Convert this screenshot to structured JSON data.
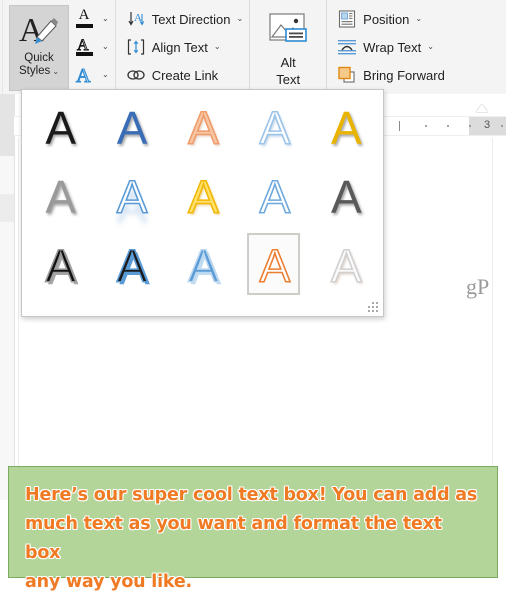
{
  "ribbon": {
    "groups": [
      {
        "name": "wordart-styles",
        "quick_styles": {
          "label_line1": "Quick",
          "label_line2": "Styles",
          "chevron": "⌄",
          "icon": "wordart-quick-styles-icon",
          "state": "selected"
        },
        "small_buttons": [
          {
            "label": "Text Fill",
            "icon": "text-fill-icon",
            "color": "#000000",
            "chevron": "⌄"
          },
          {
            "label": "Text Outline",
            "icon": "text-outline-icon",
            "color": "#000000",
            "chevron": "⌄"
          },
          {
            "label": "Text Effects",
            "icon": "text-effects-icon",
            "color": "#2e8bd4",
            "chevron": "⌄"
          }
        ]
      },
      {
        "name": "text-group",
        "items": [
          {
            "label": "Text Direction",
            "icon": "text-direction-icon",
            "chevron": "⌄"
          },
          {
            "label": "Align Text",
            "icon": "align-text-icon",
            "chevron": "⌄"
          },
          {
            "label": "Create Link",
            "icon": "create-link-icon",
            "chevron": ""
          }
        ]
      },
      {
        "name": "accessibility-group",
        "alt_text": {
          "label_line1": "Alt",
          "label_line2": "Text",
          "icon": "alt-text-picture-icon"
        }
      },
      {
        "name": "arrange-group",
        "items": [
          {
            "label": "Position",
            "icon": "position-icon",
            "chevron": "⌄"
          },
          {
            "label": "Wrap Text",
            "icon": "wrap-text-icon",
            "chevron": "⌄"
          },
          {
            "label": "Bring Forward",
            "icon": "bring-forward-icon",
            "chevron": ""
          }
        ]
      }
    ]
  },
  "gallery": {
    "name": "quick-styles-gallery",
    "letter": "A",
    "columns": 5,
    "rows": 3,
    "selected_index": 13,
    "resize_grip": "resize-grip-icon",
    "styles": [
      {
        "index": 0,
        "name": "fill-black-plain",
        "fill": "#1a1a1a",
        "outline": "none",
        "shadow": "soft-dark"
      },
      {
        "index": 1,
        "name": "fill-blue-plain",
        "fill": "#3a6db5",
        "outline": "none",
        "shadow": "soft-dark"
      },
      {
        "index": 2,
        "name": "fill-peach-outline-orange",
        "fill": "#f7c6a4",
        "outline": "#ef9c6a",
        "shadow": "soft-light"
      },
      {
        "index": 3,
        "name": "fill-white-outline-lightblue",
        "fill": "#ffffff",
        "outline": "#9cc3e8",
        "shadow": "soft-blue"
      },
      {
        "index": 4,
        "name": "fill-gold-plain",
        "fill": "#e8b400",
        "outline": "none",
        "shadow": "soft-dark"
      },
      {
        "index": 5,
        "name": "fill-gray-gradient",
        "fill": "#9a9a9a",
        "outline": "none",
        "shadow": "soft-dark"
      },
      {
        "index": 6,
        "name": "fill-white-reflect-blue",
        "fill": "#ffffff",
        "outline": "#5b9bd5",
        "shadow": "reflection-blue"
      },
      {
        "index": 7,
        "name": "fill-yellow-outline-gold",
        "fill": "#ffe16b",
        "outline": "#f2b705",
        "shadow": "soft-gold"
      },
      {
        "index": 8,
        "name": "fill-white-outline-blue-thin",
        "fill": "#ffffff",
        "outline": "#6fa8dc",
        "shadow": "none"
      },
      {
        "index": 9,
        "name": "fill-darkgray-plain",
        "fill": "#595959",
        "outline": "none",
        "shadow": "soft-dark"
      },
      {
        "index": 10,
        "name": "fill-black-shadow",
        "fill": "#111111",
        "outline": "#9a9a9a",
        "shadow": "hard-gray"
      },
      {
        "index": 11,
        "name": "fill-black-shadow-blue",
        "fill": "#1a1a1a",
        "outline": "#5b9bd5",
        "shadow": "hard-blue"
      },
      {
        "index": 12,
        "name": "fill-blue-shadow-lightblue",
        "fill": "#5b9bd5",
        "outline": "#bcd8f0",
        "shadow": "hard-lightblue"
      },
      {
        "index": 13,
        "name": "fill-white-outline-orange",
        "fill": "#ffffff",
        "outline": "#ed7d31",
        "shadow": "none"
      },
      {
        "index": 14,
        "name": "fill-white-outline-gray",
        "fill": "#fafafa",
        "outline": "#d0d0d0",
        "shadow": "soft-light"
      }
    ]
  },
  "document": {
    "ruler": {
      "name": "horizontal-ruler",
      "number": "3",
      "marker": "hanging-indent-marker"
    },
    "page_text": "gP",
    "textbox": {
      "name": "document-text-box",
      "fill_color": "#b3d59a",
      "border_color": "#7aab5e",
      "text_color": "#f07a24",
      "outline_color": "#ffffff",
      "lines": [
        "Here’s our super cool text box! You can add as",
        "much text as you want and format the text box",
        "any way you like."
      ]
    }
  }
}
